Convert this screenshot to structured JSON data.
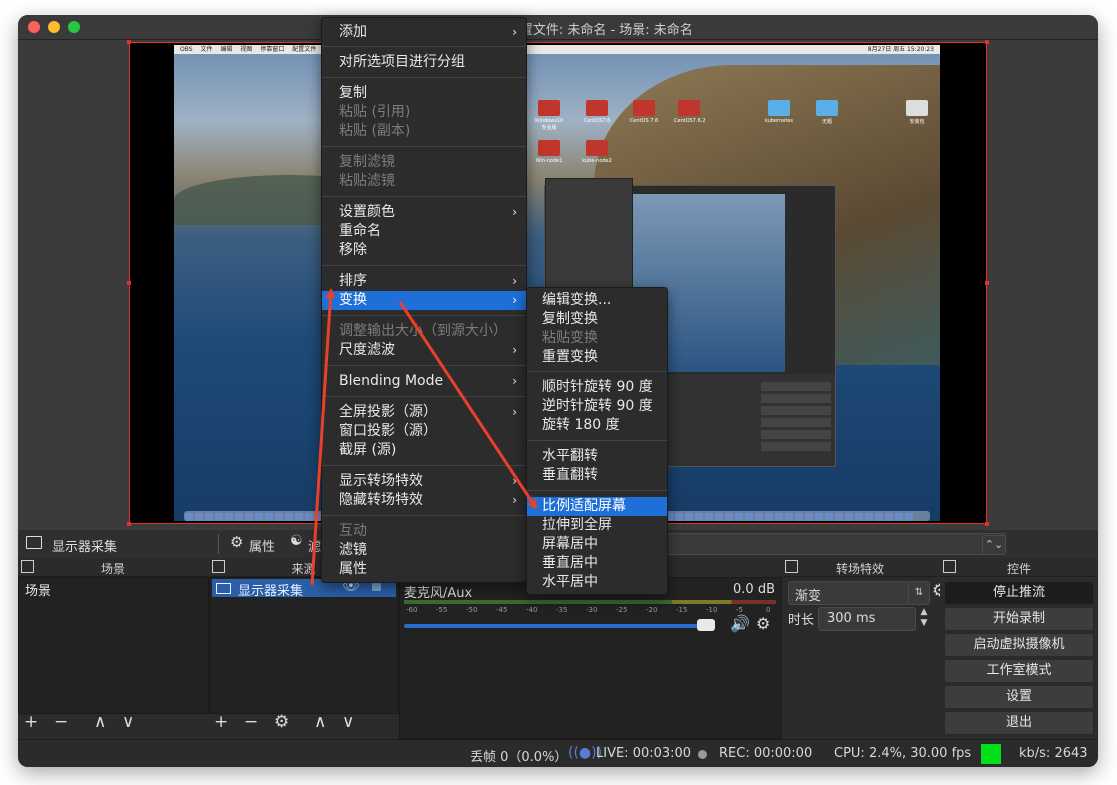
{
  "window": {
    "title": "- 配置文件: 未命名 - 场景: 未命名"
  },
  "desktop": {
    "menubar_left": [
      "OBS",
      "文件",
      "编辑",
      "视图",
      "停靠窗口",
      "配置文件"
    ],
    "menubar_right": "8月27日 周五 15:20:23",
    "icons": [
      "Windows10专业版",
      "CentOS7.6",
      "CentOS 7.6",
      "CentOS7.6.2",
      "kubernetes",
      "无题",
      "安装包",
      "Win-node1",
      "kube-node2"
    ]
  },
  "source_bar": {
    "source_name": "显示器采集",
    "properties_label": "属性",
    "filters_label": "滤"
  },
  "scenes_dock": {
    "title": "场景",
    "items": [
      "场景"
    ]
  },
  "sources_dock": {
    "title": "来源",
    "items": [
      "显示器采集"
    ]
  },
  "mixer": {
    "track_name": "麦克风/Aux",
    "db_value": "0.0 dB",
    "scale": [
      "-60",
      "-55",
      "-50",
      "-45",
      "-40",
      "-35",
      "-30",
      "-25",
      "-20",
      "-15",
      "-10",
      "-5",
      "0"
    ],
    "volume_level": 0.93
  },
  "transitions": {
    "title": "转场特效",
    "selected": "渐变",
    "duration_label": "时长",
    "duration": "300 ms"
  },
  "controls": {
    "title": "控件",
    "buttons": [
      "停止推流",
      "开始录制",
      "启动虚拟摄像机",
      "工作室模式",
      "设置",
      "退出"
    ]
  },
  "status": {
    "dropped": "丢帧 0（0.0%）",
    "live": "LIVE: 00:03:00",
    "rec": "REC: 00:00:00",
    "cpu": "CPU: 2.4%, 30.00 fps",
    "kbps": "kb/s: 2643",
    "indicator_color": "#00e01a"
  },
  "context_menu": {
    "items": [
      {
        "label": "添加",
        "submenu": true
      },
      {
        "label": "对所选项目进行分组"
      },
      {
        "label": "复制"
      },
      {
        "label": "粘贴 (引用)",
        "disabled": true
      },
      {
        "label": "粘贴 (副本)",
        "disabled": true
      },
      {
        "label": "复制滤镜",
        "disabled": true
      },
      {
        "label": "粘贴滤镜",
        "disabled": true
      },
      {
        "label": "设置颜色",
        "submenu": true
      },
      {
        "label": "重命名"
      },
      {
        "label": "移除"
      },
      {
        "label": "排序",
        "submenu": true
      },
      {
        "label": "变换",
        "submenu": true,
        "highlighted": true
      },
      {
        "label": "调整输出大小（到源大小）",
        "disabled": true
      },
      {
        "label": "尺度滤波",
        "submenu": true
      },
      {
        "label": "Blending Mode",
        "submenu": true
      },
      {
        "label": "全屏投影（源）",
        "submenu": true
      },
      {
        "label": "窗口投影（源）"
      },
      {
        "label": "截屏 (源)"
      },
      {
        "label": "显示转场特效",
        "submenu": true
      },
      {
        "label": "隐藏转场特效",
        "submenu": true
      },
      {
        "label": "互动",
        "disabled": true
      },
      {
        "label": "滤镜"
      },
      {
        "label": "属性"
      }
    ]
  },
  "transform_menu": {
    "items": [
      {
        "label": "编辑变换..."
      },
      {
        "label": "复制变换"
      },
      {
        "label": "粘贴变换",
        "disabled": true
      },
      {
        "label": "重置变换"
      },
      {
        "label": "顺时针旋转 90 度"
      },
      {
        "label": "逆时针旋转 90 度"
      },
      {
        "label": "旋转 180 度"
      },
      {
        "label": "水平翻转"
      },
      {
        "label": "垂直翻转"
      },
      {
        "label": "比例适配屏幕",
        "highlighted": true
      },
      {
        "label": "拉伸到全屏"
      },
      {
        "label": "屏幕居中"
      },
      {
        "label": "垂直居中"
      },
      {
        "label": "水平居中"
      }
    ]
  },
  "annotation_color": "#e8402a"
}
